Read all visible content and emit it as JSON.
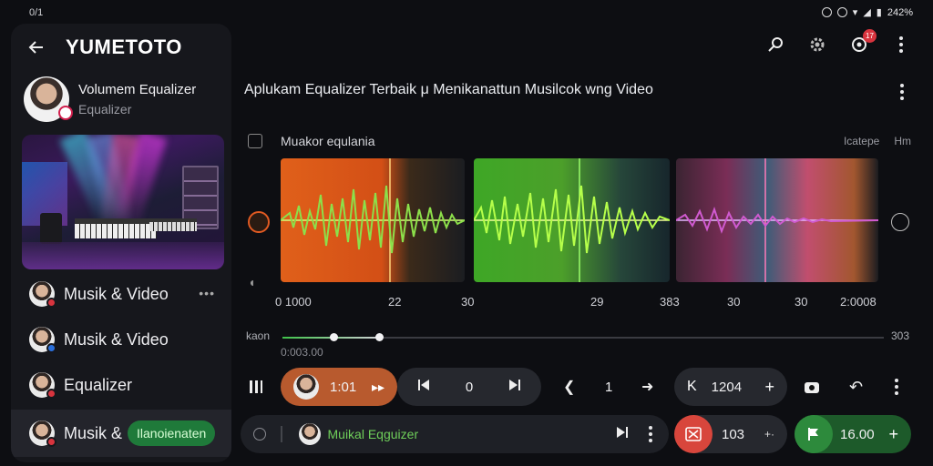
{
  "status_bar": {
    "left": "0/1",
    "right_pct": "242%"
  },
  "header": {
    "app_title": "YUMETOTO"
  },
  "profile": {
    "name": "Volumem Equalizer",
    "subtitle": "Equalizer"
  },
  "sidebar": {
    "items": [
      {
        "label": "Musik & Video",
        "dot_color": "#d8343e",
        "more": "•••"
      },
      {
        "label": "Musik & Video",
        "dot_color": "#2a6fdb"
      },
      {
        "label": "Equalizer",
        "dot_color": "#d8343e"
      },
      {
        "label": "Musik &",
        "dot_color": "#d8343e",
        "pill": "Ilanoienaten"
      }
    ]
  },
  "topbar": {
    "notification_count": "17"
  },
  "main": {
    "title": "Aplukam Equalizer Terbaik μ Menikanattun Musilcok wng Video",
    "eq_label": "Muakor equlania",
    "eq_right": [
      "Icatepe",
      "Hm"
    ],
    "ticks": [
      "0 1000",
      "22",
      "30",
      "29",
      "383",
      "30",
      "30",
      "2:0008"
    ],
    "slider_label": "kaon",
    "slider_end": "303",
    "slider_time": "0:003.00",
    "progress": 0.16
  },
  "controls": {
    "pill_value": "1:01",
    "center_value": "0",
    "step_value": "1",
    "right_value": "1204"
  },
  "bottom": {
    "search_label": "Muikal Eqguizer",
    "red_value": "103",
    "green_value": "16.00"
  },
  "colors": {
    "accent_orange": "#b85a2e",
    "accent_green": "#2d8a3c",
    "accent_red": "#d8463c"
  }
}
